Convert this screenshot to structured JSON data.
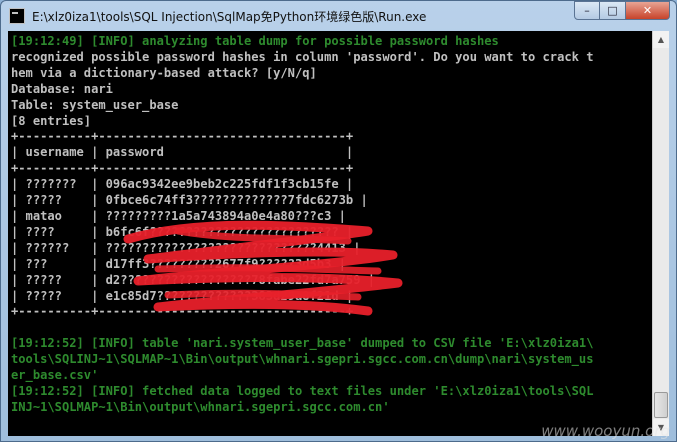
{
  "window": {
    "title": "E:\\xlz0iza1\\tools\\SQL Injection\\SqlMap免Python环境绿色版\\Run.exe",
    "icon": "console-app-icon",
    "buttons": {
      "minimize": "–",
      "maximize": "□",
      "close": "✕"
    }
  },
  "console": {
    "lines": [
      {
        "text": "[19:12:49] [INFO] analyzing table dump for possible password hashes",
        "color": "green"
      },
      {
        "text": "recognized possible password hashes in column 'password'. Do you want to crack t",
        "color": "gray"
      },
      {
        "text": "hem via a dictionary-based attack? [y/N/q]",
        "color": "gray"
      },
      {
        "text": "Database: nari",
        "color": "gray"
      },
      {
        "text": "Table: system_user_base",
        "color": "gray"
      },
      {
        "text": "[8 entries]",
        "color": "gray"
      },
      {
        "text": "+----------+----------------------------------+",
        "color": "gray"
      },
      {
        "text": "| username | password                         |",
        "color": "gray"
      },
      {
        "text": "+----------+----------------------------------+",
        "color": "gray"
      },
      {
        "text": "| ???????  | 096ac9342ee9beb2c225fdf1f3cb15fe |",
        "color": "gray"
      },
      {
        "text": "| ?????    | 0fbce6c74ff3?????????????7fdc6273b |",
        "color": "gray"
      },
      {
        "text": "| matao    | ?????????1a5a743894a0e4a80???c3 |",
        "color": "gray"
      },
      {
        "text": "| ????     | b6fc6f?????????????????????????? |",
        "color": "gray"
      },
      {
        "text": "| ??????   | ?????????????????????????????4413 |",
        "color": "gray"
      },
      {
        "text": "| ???      | d17ff3?????????2677f9?????3d5b3 |",
        "color": "gray"
      },
      {
        "text": "| ?????    | d2??????????????????78fabe22fd7a759 |",
        "color": "gray"
      },
      {
        "text": "| ?????    | e1c85d7?????????????383d29a8f21d |",
        "color": "gray"
      },
      {
        "text": "+----------+----------------------------------+",
        "color": "gray"
      },
      {
        "text": "",
        "color": "gray"
      },
      {
        "text": "[19:12:52] [INFO] table 'nari.system_user_base' dumped to CSV file 'E:\\xlz0iza1\\",
        "color": "green"
      },
      {
        "text": "tools\\SQLINJ~1\\SQLMAP~1\\Bin\\output\\whnari.sgepri.sgcc.com.cn\\dump\\nari\\system_us",
        "color": "green"
      },
      {
        "text": "er_base.csv'",
        "color": "green"
      },
      {
        "text": "[19:12:52] [INFO] fetched data logged to text files under 'E:\\xlz0iza1\\tools\\SQL",
        "color": "green"
      },
      {
        "text": "INJ~1\\SQLMAP~1\\Bin\\output\\whnari.sgepri.sgcc.com.cn'",
        "color": "green"
      }
    ]
  },
  "scrollbar": {
    "up_icon": "▲",
    "down_icon": "▼"
  },
  "watermark": "www.wooyun.org",
  "colors": {
    "green_text": "#2e8b2e",
    "gray_text": "#c0c0c0",
    "background": "#000000",
    "redaction": "#e8202a"
  }
}
